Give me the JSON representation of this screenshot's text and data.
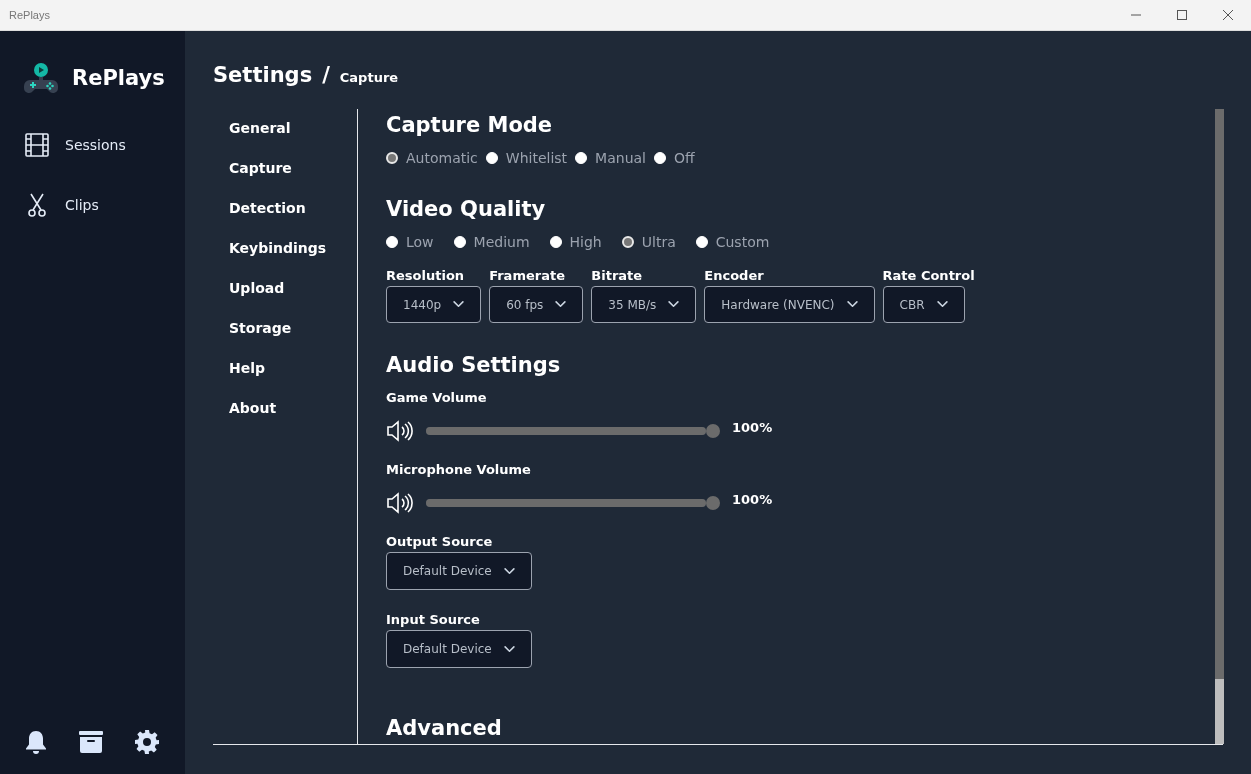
{
  "window": {
    "title": "RePlays"
  },
  "sidebar": {
    "app_name": "RePlays",
    "items": [
      {
        "label": "Sessions"
      },
      {
        "label": "Clips"
      }
    ]
  },
  "header": {
    "title": "Settings",
    "separator": "/",
    "subtitle": "Capture"
  },
  "settings_nav": [
    {
      "label": "General"
    },
    {
      "label": "Capture"
    },
    {
      "label": "Detection"
    },
    {
      "label": "Keybindings"
    },
    {
      "label": "Upload"
    },
    {
      "label": "Storage"
    },
    {
      "label": "Help"
    },
    {
      "label": "About"
    }
  ],
  "capture_mode": {
    "title": "Capture Mode",
    "options": [
      {
        "label": "Automatic",
        "selected": true
      },
      {
        "label": "Whitelist",
        "selected": false
      },
      {
        "label": "Manual",
        "selected": false
      },
      {
        "label": "Off",
        "selected": false
      }
    ]
  },
  "video_quality": {
    "title": "Video Quality",
    "options": [
      {
        "label": "Low",
        "selected": false
      },
      {
        "label": "Medium",
        "selected": false
      },
      {
        "label": "High",
        "selected": false
      },
      {
        "label": "Ultra",
        "selected": true
      },
      {
        "label": "Custom",
        "selected": false
      }
    ],
    "dropdowns": [
      {
        "label": "Resolution",
        "value": "1440p"
      },
      {
        "label": "Framerate",
        "value": "60 fps"
      },
      {
        "label": "Bitrate",
        "value": "35 MB/s"
      },
      {
        "label": "Encoder",
        "value": "Hardware (NVENC)"
      },
      {
        "label": "Rate Control",
        "value": "CBR"
      }
    ]
  },
  "audio": {
    "title": "Audio Settings",
    "volumes": [
      {
        "label": "Game Volume",
        "level": 1,
        "reading": "100%"
      },
      {
        "label": "Microphone Volume",
        "level": 1,
        "reading": "100%"
      }
    ],
    "sources": [
      {
        "label": "Output Source",
        "value": "Default Device"
      },
      {
        "label": "Input Source",
        "value": "Default Device"
      }
    ]
  },
  "advanced": {
    "title": "Advanced"
  }
}
